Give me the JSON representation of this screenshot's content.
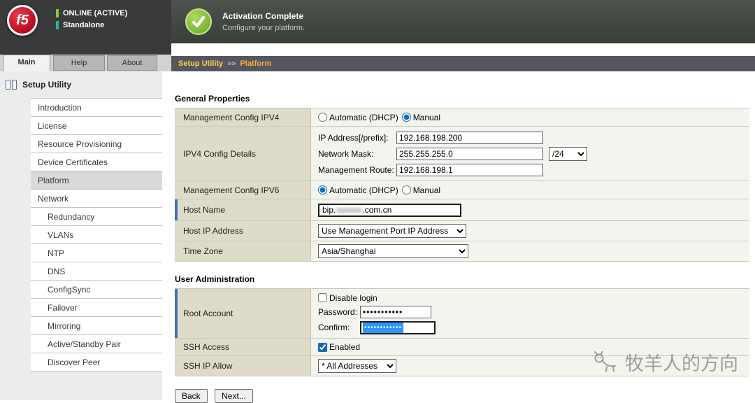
{
  "header": {
    "logo_text": "f5",
    "status_primary": "ONLINE (ACTIVE)",
    "status_secondary": "Standalone",
    "banner": {
      "title": "Activation Complete",
      "subtitle": "Configure your platform."
    }
  },
  "tabs": {
    "main": "Main",
    "help": "Help",
    "about": "About"
  },
  "breadcrumb": {
    "root": "Setup Utility",
    "separator": "»»",
    "current": "Platform"
  },
  "sidebar": {
    "title": "Setup Utility",
    "items": [
      {
        "label": "Introduction",
        "indent": false,
        "active": false
      },
      {
        "label": "License",
        "indent": false,
        "active": false
      },
      {
        "label": "Resource Provisioning",
        "indent": false,
        "active": false
      },
      {
        "label": "Device Certificates",
        "indent": false,
        "active": false
      },
      {
        "label": "Platform",
        "indent": false,
        "active": true
      },
      {
        "label": "Network",
        "indent": false,
        "active": false
      },
      {
        "label": "Redundancy",
        "indent": true,
        "active": false
      },
      {
        "label": "VLANs",
        "indent": true,
        "active": false
      },
      {
        "label": "NTP",
        "indent": true,
        "active": false
      },
      {
        "label": "DNS",
        "indent": true,
        "active": false
      },
      {
        "label": "ConfigSync",
        "indent": true,
        "active": false
      },
      {
        "label": "Failover",
        "indent": true,
        "active": false
      },
      {
        "label": "Mirroring",
        "indent": true,
        "active": false
      },
      {
        "label": "Active/Standby Pair",
        "indent": true,
        "active": false
      },
      {
        "label": "Discover Peer",
        "indent": true,
        "active": false
      }
    ]
  },
  "general": {
    "title": "General Properties",
    "mgmt_ipv4": {
      "label": "Management Config IPV4",
      "option_auto": "Automatic (DHCP)",
      "option_manual": "Manual",
      "auto_selected": false,
      "manual_selected": true
    },
    "ipv4_details": {
      "label": "IPV4 Config Details",
      "ip_label": "IP Address[/prefix]:",
      "ip_value": "192.168.198.200",
      "mask_label": "Network Mask:",
      "mask_value": "255.255.255.0",
      "prefix_option": "/24",
      "route_label": "Management Route:",
      "route_value": "192.168.198.1"
    },
    "mgmt_ipv6": {
      "label": "Management Config IPV6",
      "option_auto": "Automatic (DHCP)",
      "option_manual": "Manual",
      "auto_selected": true,
      "manual_selected": false
    },
    "host_name": {
      "label": "Host Name",
      "value_prefix": "bip.",
      "value_blurred": "xxxxxx",
      "value_suffix": ".com.cn"
    },
    "host_ip": {
      "label": "Host IP Address",
      "value": "Use Management Port IP Address"
    },
    "time_zone": {
      "label": "Time Zone",
      "value": "Asia/Shanghai"
    }
  },
  "user_admin": {
    "title": "User Administration",
    "root_account": {
      "label": "Root Account",
      "disable_login_label": "Disable login",
      "disable_login_checked": false,
      "password_label": "Password:",
      "password_value": "•••••••••••",
      "confirm_label": "Confirm:",
      "confirm_value": "••••••••••••"
    },
    "ssh_access": {
      "label": "SSH Access",
      "option_label": "Enabled",
      "checked": true
    },
    "ssh_allow": {
      "label": "SSH IP Allow",
      "value": "* All Addresses"
    }
  },
  "buttons": {
    "back": "Back",
    "next": "Next..."
  },
  "watermark": {
    "text": "牧羊人的方向"
  },
  "colors": {
    "accent_blue": "#4472b0",
    "label_cell": "#dedcc9",
    "breadcrumb_root": "#ffd24d",
    "breadcrumb_current": "#ffaa44",
    "success_green": "#7ab648",
    "f5_red": "#b50a1c",
    "selection_blue": "#3094fa"
  }
}
